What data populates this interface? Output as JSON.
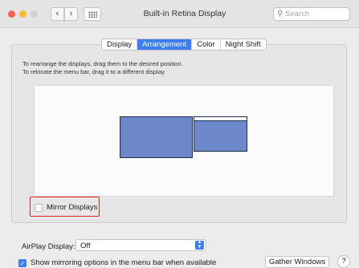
{
  "window": {
    "title": "Built-in Retina Display",
    "back_glyph": "‹",
    "forward_glyph": "›",
    "search_placeholder": "Search"
  },
  "tabs": [
    {
      "label": "Display",
      "active": false
    },
    {
      "label": "Arrangement",
      "active": true
    },
    {
      "label": "Color",
      "active": false
    },
    {
      "label": "Night Shift",
      "active": false
    }
  ],
  "arrangement": {
    "instruction_line1": "To rearrange the displays, drag them to the desired position.",
    "instruction_line2": "To relocate the menu bar, drag it to a different display.",
    "mirror_label": "Mirror Displays",
    "mirror_checked": false
  },
  "airplay": {
    "label": "AirPlay Display:",
    "value": "Off"
  },
  "footer": {
    "show_mirroring_label": "Show mirroring options in the menu bar when available",
    "show_mirroring_checked": true,
    "gather_label": "Gather Windows",
    "help_label": "?"
  },
  "colors": {
    "accent": "#3b7ef5",
    "display_fill": "#6d88c9",
    "highlight": "#e02424"
  }
}
